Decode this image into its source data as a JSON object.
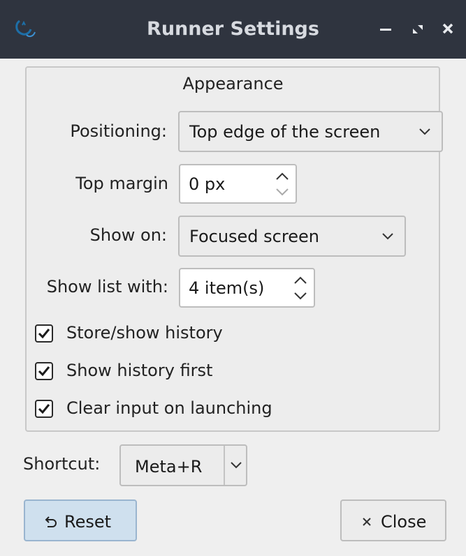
{
  "window": {
    "title": "Runner Settings",
    "icons": {
      "app": "runner-app-icon",
      "minimize": "minimize-icon",
      "maximize": "maximize-icon",
      "close": "close-icon"
    }
  },
  "appearance": {
    "group_title": "Appearance",
    "positioning": {
      "label": "Positioning:",
      "value": "Top edge of the screen"
    },
    "top_margin": {
      "label": "Top margin",
      "value": "0 px"
    },
    "show_on": {
      "label": "Show on:",
      "value": "Focused screen"
    },
    "show_list": {
      "label": "Show list with:",
      "value": "4 item(s)"
    },
    "checkboxes": [
      {
        "label": "Store/show history",
        "checked": true
      },
      {
        "label": "Show history first",
        "checked": true
      },
      {
        "label": "Clear input on launching",
        "checked": true
      }
    ]
  },
  "shortcut": {
    "label": "Shortcut:",
    "value": "Meta+R"
  },
  "buttons": {
    "reset": {
      "label": "Reset",
      "icon": "undo-icon"
    },
    "close": {
      "label": "Close",
      "icon": "close-x-icon"
    }
  },
  "colors": {
    "titlebar": "#2f343f",
    "reset_bg": "#cfe0ee",
    "window_bg": "#efefef"
  }
}
